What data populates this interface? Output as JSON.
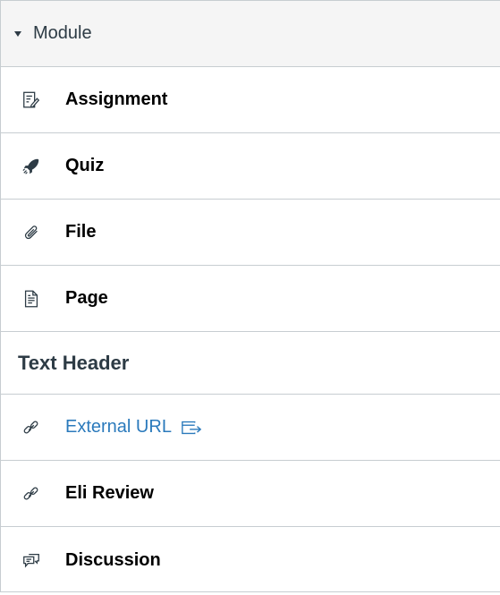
{
  "module": {
    "title": "Module",
    "expanded": true
  },
  "items": [
    {
      "type": "assignment",
      "label": "Assignment",
      "icon": "assignment-icon"
    },
    {
      "type": "quiz",
      "label": "Quiz",
      "icon": "rocket-quiz-icon"
    },
    {
      "type": "file",
      "label": "File",
      "icon": "paperclip-icon"
    },
    {
      "type": "page",
      "label": "Page",
      "icon": "document-page-icon"
    },
    {
      "type": "subheader",
      "label": "Text Header"
    },
    {
      "type": "external_url",
      "label": "External URL",
      "icon": "link-icon",
      "trailing_icon": "external-link-icon"
    },
    {
      "type": "external_tool",
      "label": "Eli Review",
      "icon": "link-icon"
    },
    {
      "type": "discussion",
      "label": "Discussion",
      "icon": "discussion-icon"
    }
  ],
  "colors": {
    "link": "#2b7abc",
    "text": "#000000",
    "header_bg": "#f5f5f5",
    "border": "#c7cdd1"
  }
}
